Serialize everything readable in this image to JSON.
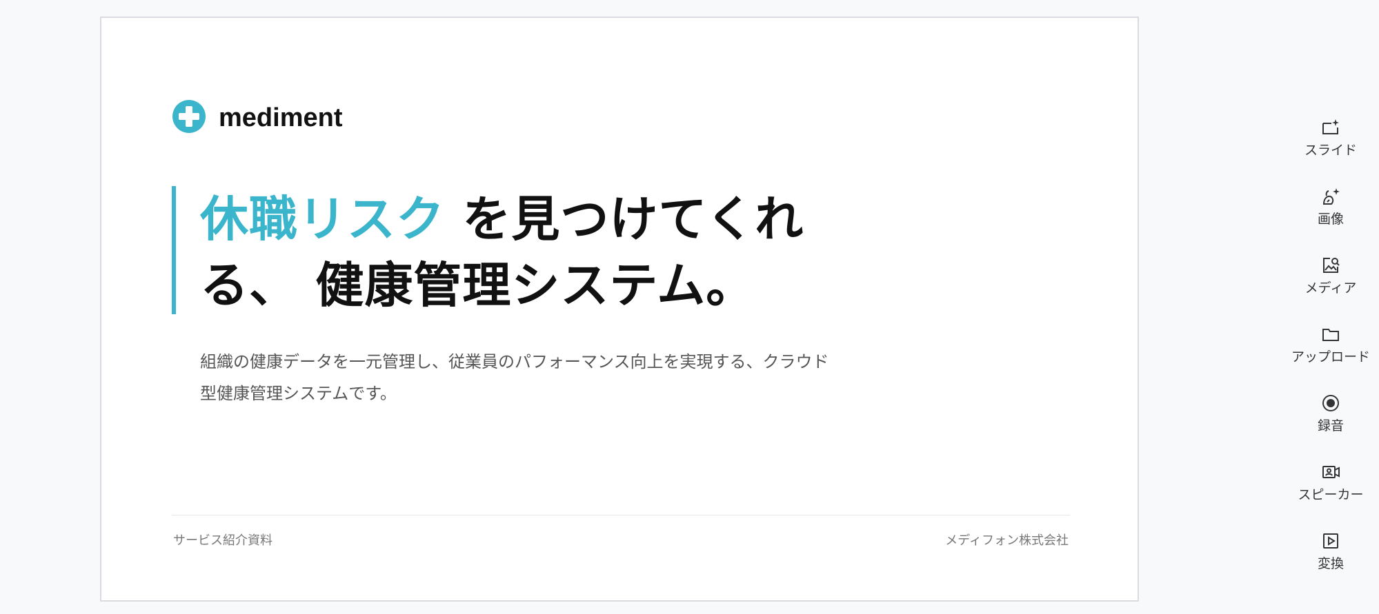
{
  "slide": {
    "logo": {
      "icon": "medical-cross-icon",
      "text": "mediment",
      "color": "#3ab5cc"
    },
    "headline": {
      "accent": "休職リスク",
      "rest_line1": " を見つけてくれ",
      "line2": "る、 健康管理システム。",
      "accent_color": "#3ab5cc"
    },
    "description": {
      "line1": "組織の健康データを一元管理し、従業員のパフォーマンス向上を実現する、クラウド",
      "line2": "型健康管理システムです。"
    },
    "footer": {
      "left": "サービス紹介資料",
      "right": "メディフォン株式会社"
    }
  },
  "toolbar": {
    "items": [
      {
        "label": "スライド",
        "icon": "slide-sparkle-icon"
      },
      {
        "label": "画像",
        "icon": "image-sparkle-icon"
      },
      {
        "label": "メディア",
        "icon": "media-search-icon"
      },
      {
        "label": "アップロード",
        "icon": "folder-icon"
      },
      {
        "label": "録音",
        "icon": "record-icon"
      },
      {
        "label": "スピーカー",
        "icon": "speaker-video-icon"
      },
      {
        "label": "変換",
        "icon": "play-box-icon"
      }
    ]
  }
}
